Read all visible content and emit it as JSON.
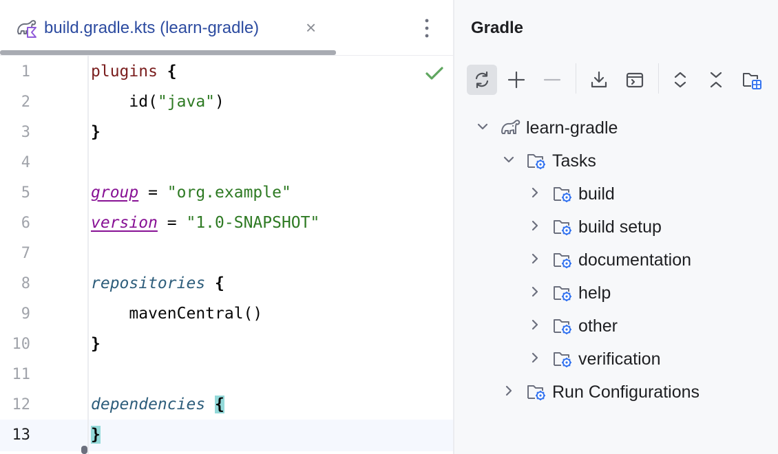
{
  "editor": {
    "tab": {
      "title": "build.gradle.kts (learn-gradle)",
      "close": "×"
    },
    "current_line": "13",
    "lines": [
      {
        "n": "1",
        "parts": [
          {
            "t": "plugins",
            "c": "kw"
          },
          {
            "t": " "
          },
          {
            "t": "{",
            "c": "brace"
          }
        ]
      },
      {
        "n": "2",
        "parts": [
          {
            "t": "    id("
          },
          {
            "t": "\"java\"",
            "c": "str"
          },
          {
            "t": ")"
          }
        ]
      },
      {
        "n": "3",
        "parts": [
          {
            "t": "}",
            "c": "brace"
          }
        ]
      },
      {
        "n": "4",
        "parts": []
      },
      {
        "n": "5",
        "parts": [
          {
            "t": "group",
            "c": "prop"
          },
          {
            "t": " = "
          },
          {
            "t": "\"org.example\"",
            "c": "str"
          }
        ]
      },
      {
        "n": "6",
        "parts": [
          {
            "t": "version",
            "c": "prop"
          },
          {
            "t": " = "
          },
          {
            "t": "\"1.0-SNAPSHOT\"",
            "c": "str"
          }
        ]
      },
      {
        "n": "7",
        "parts": []
      },
      {
        "n": "8",
        "parts": [
          {
            "t": "repositories",
            "c": "fn"
          },
          {
            "t": " "
          },
          {
            "t": "{",
            "c": "brace"
          }
        ]
      },
      {
        "n": "9",
        "parts": [
          {
            "t": "    mavenCentral()"
          }
        ]
      },
      {
        "n": "10",
        "parts": [
          {
            "t": "}",
            "c": "brace"
          }
        ]
      },
      {
        "n": "11",
        "parts": []
      },
      {
        "n": "12",
        "parts": [
          {
            "t": "dependencies",
            "c": "fn"
          },
          {
            "t": " "
          },
          {
            "t": "{",
            "c": "brace match"
          }
        ]
      },
      {
        "n": "13",
        "parts": [
          {
            "t": "}",
            "c": "brace match"
          }
        ]
      }
    ]
  },
  "gradle": {
    "title": "Gradle",
    "toolbar": [
      "reload-icon",
      "add-icon",
      "remove-icon",
      "download-icon",
      "run-task-icon",
      "expand-all-icon",
      "collapse-all-icon",
      "group-modules-icon"
    ],
    "tree": [
      {
        "label": "learn-gradle",
        "level": 0,
        "expanded": true,
        "icon": "gradle-elephant-icon"
      },
      {
        "label": "Tasks",
        "level": 1,
        "expanded": true,
        "icon": "task-folder-icon"
      },
      {
        "label": "build",
        "level": 2,
        "expanded": false,
        "icon": "task-folder-icon"
      },
      {
        "label": "build setup",
        "level": 2,
        "expanded": false,
        "icon": "task-folder-icon"
      },
      {
        "label": "documentation",
        "level": 2,
        "expanded": false,
        "icon": "task-folder-icon"
      },
      {
        "label": "help",
        "level": 2,
        "expanded": false,
        "icon": "task-folder-icon"
      },
      {
        "label": "other",
        "level": 2,
        "expanded": false,
        "icon": "task-folder-icon"
      },
      {
        "label": "verification",
        "level": 2,
        "expanded": false,
        "icon": "task-folder-icon"
      },
      {
        "label": "Run Configurations",
        "level": 1,
        "expanded": false,
        "icon": "task-folder-icon"
      }
    ]
  },
  "colors": {
    "accent": "#2c4ba0",
    "keyword": "#7a1e1e",
    "string": "#2e7a23",
    "property": "#871094",
    "function": "#2d5d7b",
    "check": "#5fa65f",
    "brace_match": "#93d9d9",
    "folder_gear": "#3574f0"
  }
}
